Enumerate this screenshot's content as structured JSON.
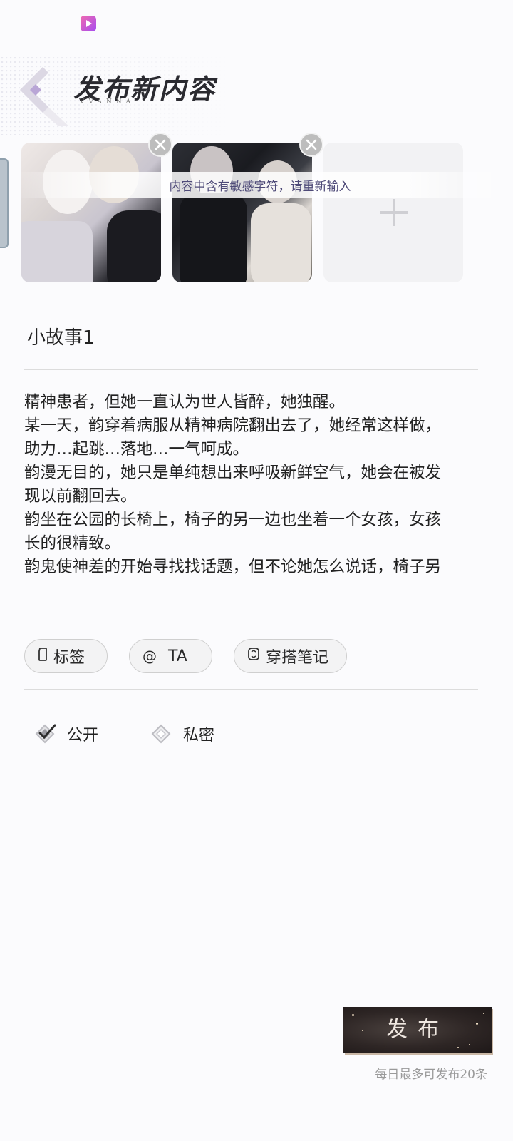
{
  "header": {
    "title": "发布新内容",
    "subtitle": "VVANNA"
  },
  "images": {
    "count_shown": 2
  },
  "toast": {
    "message": "内容中含有敏感字符，请重新输入"
  },
  "post": {
    "title_value": "小故事1",
    "body_lines": [
      "精神患者，但她一直认为世人皆醉，她独醒。",
      "某一天，韵穿着病服从精神病院翻出去了，她经常这样做，",
      "助力…起跳…落地…一气呵成。",
      "韵漫无目的，她只是单纯想出来呼吸新鲜空气，她会在被发",
      "现以前翻回去。",
      "韵坐在公园的长椅上，椅子的另一边也坐着一个女孩，女孩",
      "长的很精致。",
      "韵鬼使神差的开始寻找找话题，但不论她怎么说话，椅子另"
    ]
  },
  "chips": {
    "tag_label": "标签",
    "at_label": "TA",
    "note_label": "穿搭笔记"
  },
  "visibility": {
    "public_label": "公开",
    "private_label": "私密",
    "selected": "公开"
  },
  "publish": {
    "button_label": "发布",
    "limit_note": "每日最多可发布20条"
  }
}
